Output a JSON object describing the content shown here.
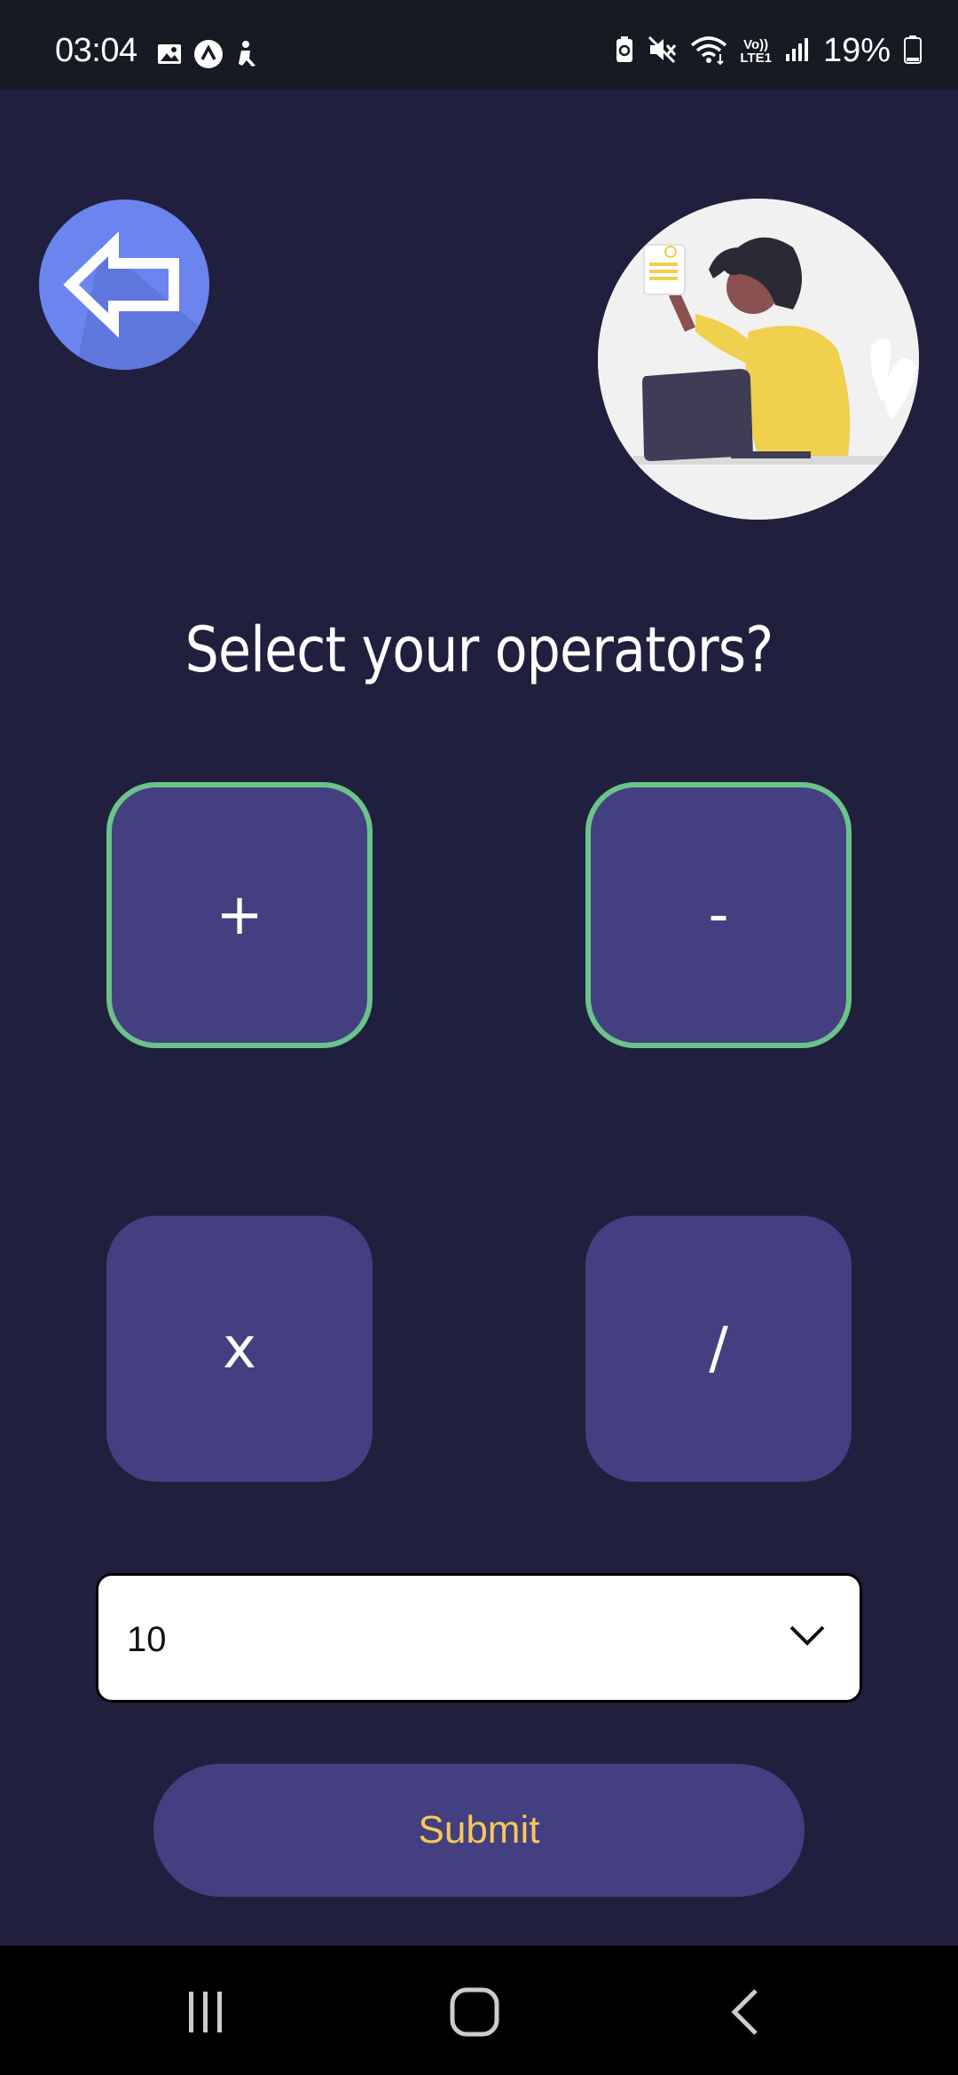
{
  "status_bar": {
    "time": "03:04",
    "battery_percent": "19%",
    "network_label_top": "Vo))",
    "network_label_bottom": "LTE1",
    "left_icons": [
      "gallery-icon",
      "app-logo-icon",
      "accessibility-icon"
    ],
    "right_icons": [
      "battery-saver-icon",
      "mute-icon",
      "wifi-icon",
      "lte-icon",
      "signal-icon",
      "battery-icon"
    ]
  },
  "header": {
    "back_icon": "back-arrow-icon",
    "illustration": "person-with-laptop-illustration"
  },
  "main": {
    "title": "Select your operators?",
    "operators": [
      {
        "symbol": "+",
        "selected": true
      },
      {
        "symbol": "-",
        "selected": true
      },
      {
        "symbol": "x",
        "selected": false
      },
      {
        "symbol": "/",
        "selected": false
      }
    ],
    "question_count": {
      "selected_value": "10"
    },
    "submit_label": "Submit"
  },
  "nav_bar": {
    "items": [
      "recent-apps-icon",
      "home-icon",
      "back-icon"
    ]
  },
  "colors": {
    "background": "#201F3E",
    "button": "#433F80",
    "selected_border": "#6BC38A",
    "submit_text": "#F5C85A",
    "back_button": "#6B84EE"
  }
}
